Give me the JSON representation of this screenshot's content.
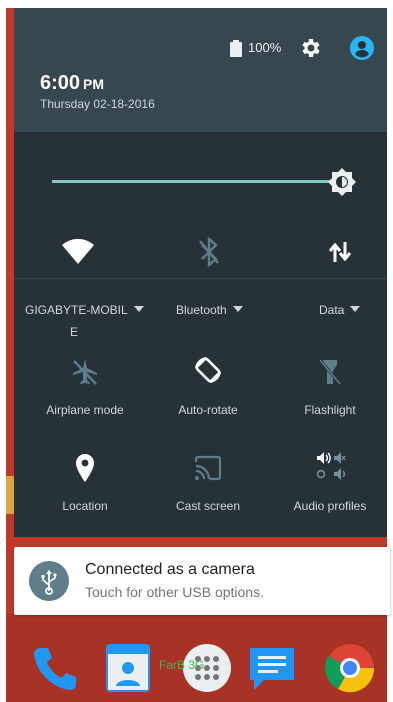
{
  "status": {
    "battery_text": "100%"
  },
  "header": {
    "time": "6:00",
    "ampm": "PM",
    "date": "Thursday 02-18-2016"
  },
  "quick_settings": {
    "brightness_level": 0.9,
    "network_label": "GIGABYTE-MOBIL",
    "network_label_cont": "E",
    "bluetooth_label": "Bluetooth",
    "data_label": "Data",
    "tiles": [
      {
        "label": "Airplane mode",
        "icon": "airplane-off-icon"
      },
      {
        "label": "Auto-rotate",
        "icon": "auto-rotate-icon"
      },
      {
        "label": "Flashlight",
        "icon": "flashlight-off-icon"
      },
      {
        "label": "Location",
        "icon": "location-icon"
      },
      {
        "label": "Cast screen",
        "icon": "cast-icon"
      },
      {
        "label": "Audio profiles",
        "icon": "audio-profiles-icon"
      }
    ]
  },
  "notification": {
    "title": "Connected as a camera",
    "text": "Touch for other USB options.",
    "icon": "usb-icon"
  },
  "dock": {
    "partial_text": "FarB 3G"
  },
  "colors": {
    "accent": "#80cbc4",
    "header_bg": "#37474f",
    "panel_bg": "#263238",
    "account": "#29b6f6"
  }
}
